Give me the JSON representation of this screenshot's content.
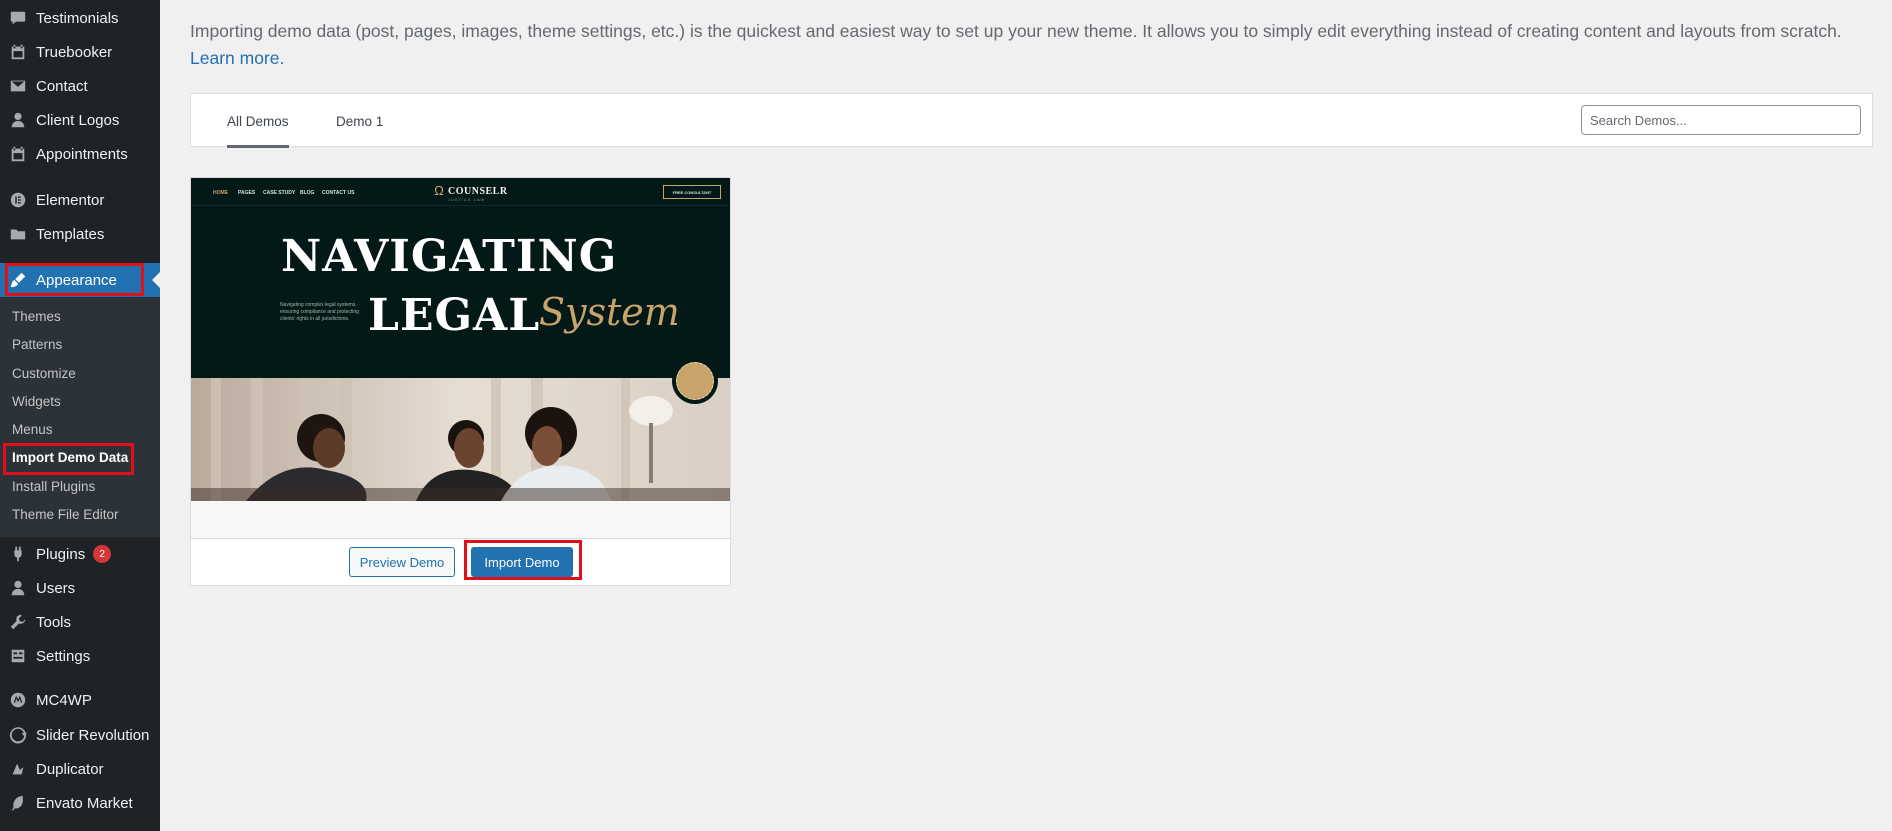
{
  "sidebar": {
    "items": [
      {
        "label": "Testimonials",
        "icon": "speech-bubble-icon"
      },
      {
        "label": "Truebooker",
        "icon": "calendar-icon"
      },
      {
        "label": "Contact",
        "icon": "envelope-icon"
      },
      {
        "label": "Client Logos",
        "icon": "user-icon"
      },
      {
        "label": "Appointments",
        "icon": "calendar-icon"
      },
      {
        "label": "Elementor",
        "icon": "elementor-icon"
      },
      {
        "label": "Templates",
        "icon": "folder-icon"
      },
      {
        "label": "Appearance",
        "icon": "paintbrush-icon"
      },
      {
        "label": "Plugins",
        "icon": "plug-icon",
        "badge": "2"
      },
      {
        "label": "Users",
        "icon": "user-icon"
      },
      {
        "label": "Tools",
        "icon": "wrench-icon"
      },
      {
        "label": "Settings",
        "icon": "settings-icon"
      },
      {
        "label": "MC4WP",
        "icon": "mc4wp-icon"
      },
      {
        "label": "Slider Revolution",
        "icon": "refresh-icon"
      },
      {
        "label": "Duplicator",
        "icon": "duplicator-icon"
      },
      {
        "label": "Envato Market",
        "icon": "leaf-icon"
      }
    ],
    "submenu": [
      {
        "label": "Themes"
      },
      {
        "label": "Patterns"
      },
      {
        "label": "Customize"
      },
      {
        "label": "Widgets"
      },
      {
        "label": "Menus"
      },
      {
        "label": "Import Demo Data"
      },
      {
        "label": "Install Plugins"
      },
      {
        "label": "Theme File Editor"
      }
    ]
  },
  "intro": {
    "text": "Importing demo data (post, pages, images, theme settings, etc.) is the quickest and easiest way to set up your new theme. It allows you to simply edit everything instead of creating content and layouts from scratch. ",
    "link": "Learn more."
  },
  "tabs": [
    {
      "label": "All Demos",
      "selected": true
    },
    {
      "label": "Demo 1",
      "selected": false
    }
  ],
  "search": {
    "placeholder": "Search Demos..."
  },
  "demo": {
    "preview": {
      "nav": [
        "HOME",
        "PAGES",
        "CASE STUDY",
        "BLOG",
        "CONTACT US"
      ],
      "logo": "COUNSELR",
      "logo_tag": "JUSTICE LAW",
      "cta": "FREE CONSULTANT",
      "headline_1": "NAVIGATING",
      "headline_2": "LEGAL",
      "headline_3": "System",
      "subtext": "Navigating complex legal systems, ensuring compliance and protecting clients' rights in all jurisdictions."
    },
    "preview_button": "Preview Demo",
    "import_button": "Import Demo"
  },
  "colors": {
    "sidebar_bg": "#1d2327",
    "submenu_bg": "#2c3338",
    "accent": "#2271b1",
    "highlight": "#e0101a",
    "badge": "#d63638",
    "gold": "#c8a46a"
  }
}
